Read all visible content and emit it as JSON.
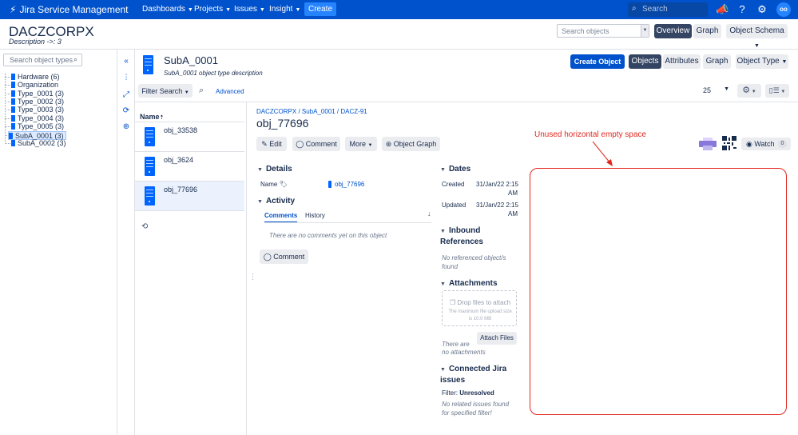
{
  "nav": {
    "logo": "Jira Service Management",
    "items": [
      "Dashboards",
      "Projects",
      "Issues",
      "Insight"
    ],
    "create": "Create",
    "search_placeholder": "Search",
    "avatar": "oo"
  },
  "header": {
    "title": "DACZCORPX",
    "description": "Description ->: 3",
    "search_placeholder": "Search objects",
    "overview": "Overview",
    "graph": "Graph",
    "object_schema": "Object Schema"
  },
  "tree": {
    "search_placeholder": "Search object types",
    "items": [
      "Hardware (6)",
      "Organization",
      "Type_0001 (3)",
      "Type_0002 (3)",
      "Type_0003 (3)",
      "Type_0004 (3)",
      "Type_0005 (3)",
      "SubA_0001 (3)",
      "SubA_0002 (3)"
    ],
    "selected_index": 7
  },
  "object_type": {
    "title": "SubA_0001",
    "description": "SubA_0001 object type description",
    "create_object": "Create Object",
    "objects": "Objects",
    "attributes": "Attributes",
    "graph": "Graph",
    "object_type": "Object Type"
  },
  "filter": {
    "filter_search": "Filter Search",
    "advanced": "Advanced",
    "page_size": "25"
  },
  "list": {
    "header": "Name",
    "rows": [
      "obj_33538",
      "obj_3624",
      "obj_77696"
    ],
    "selected_index": 2
  },
  "detail": {
    "breadcrumb": "DACZCORPX / SubA_0001 / DACZ-91",
    "title": "obj_77696",
    "edit": "Edit",
    "comment": "Comment",
    "more": "More",
    "object_graph": "Object Graph",
    "watch": "Watch",
    "watch_count": "0",
    "details_heading": "Details",
    "name_label": "Name",
    "name_value": "obj_77696",
    "activity_heading": "Activity",
    "tab_comments": "Comments",
    "tab_history": "History",
    "no_comments": "There are no comments yet on this object",
    "comment_button": "Comment",
    "dates_heading": "Dates",
    "created_label": "Created",
    "created_value_1": "31/Jan/22 2:15",
    "created_value_2": "AM",
    "updated_label": "Updated",
    "updated_value_1": "31/Jan/22 2:15",
    "updated_value_2": "AM",
    "inbound_heading_1": "Inbound",
    "inbound_heading_2": "References",
    "no_refs_1": "No referenced object/s",
    "no_refs_2": "found",
    "attachments_heading": "Attachments",
    "drop_files": "Drop files to attach",
    "max_size_1": "The maximum file upload size",
    "max_size_2": "is 10.0 MB",
    "attach_files": "Attach Files",
    "no_attach_1": "There are",
    "no_attach_2": "no attachments",
    "jira_heading_1": "Connected Jira",
    "jira_heading_2": "issues",
    "filter_label": "Filter:",
    "filter_value": "Unresolved",
    "no_issues_1": "No related issues found",
    "no_issues_2": "for specified filter!"
  },
  "annotation": {
    "text": "Unused horizontal empty space",
    "color": "#e0271e"
  },
  "colors": {
    "brand": "#0052cc",
    "create": "#2684ff",
    "object_icon": "#0065ff"
  }
}
